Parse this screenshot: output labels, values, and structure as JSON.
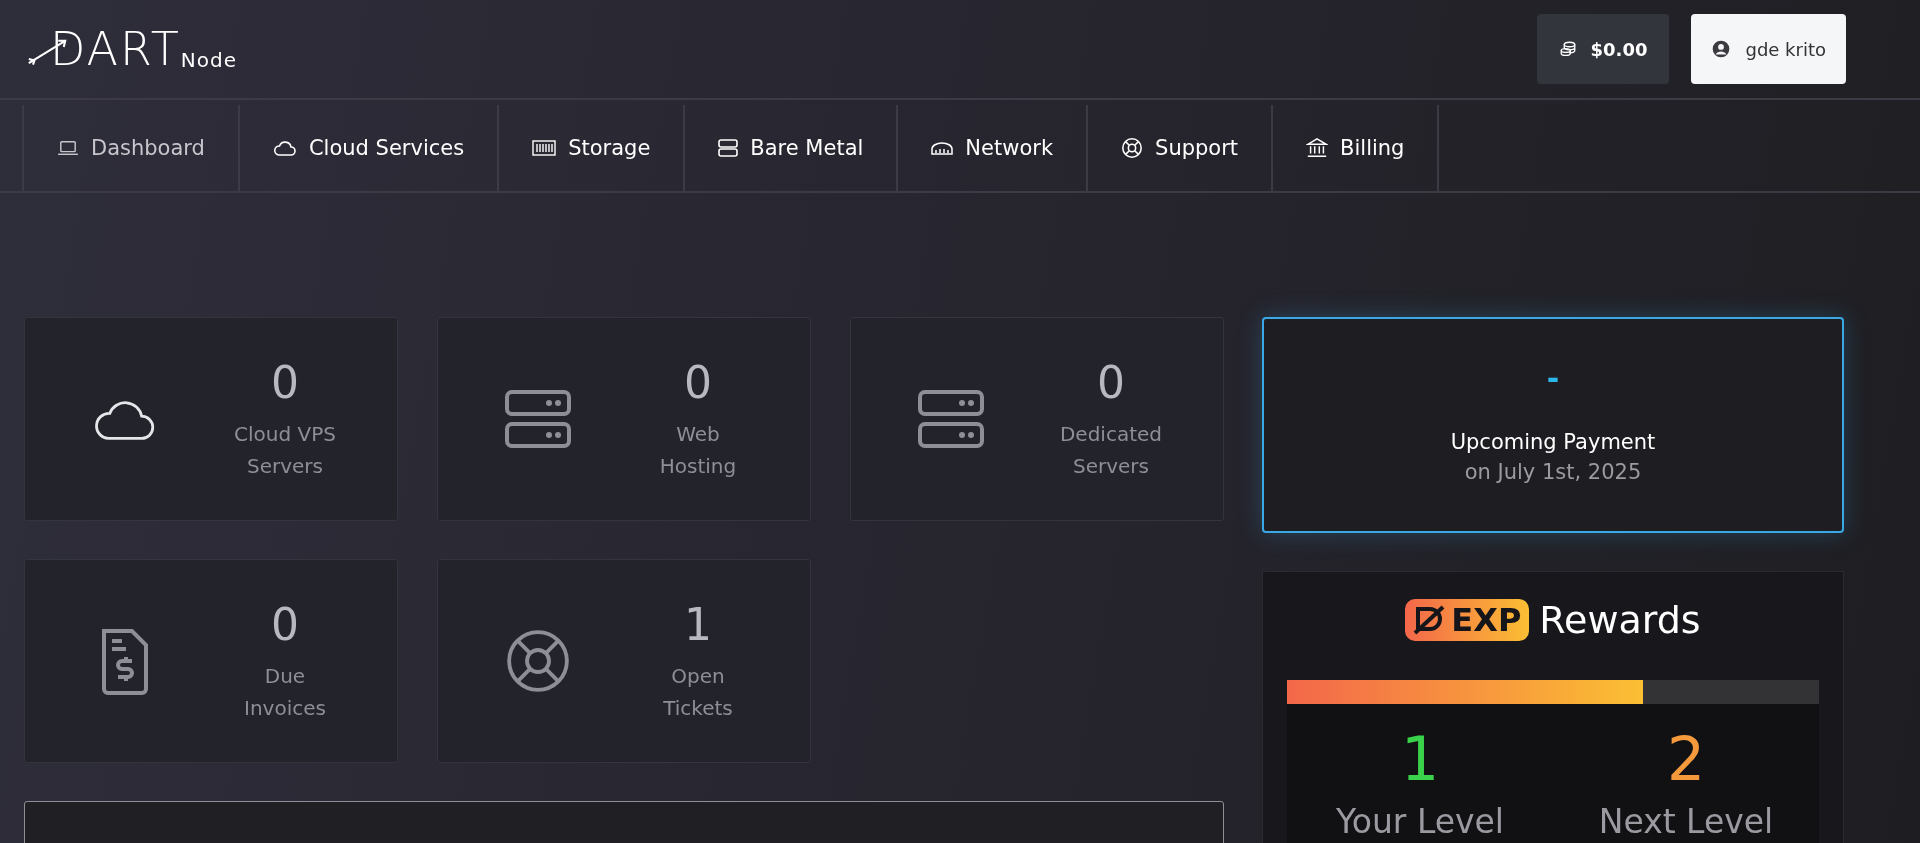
{
  "logo": {
    "main": "DART",
    "sub": "Node"
  },
  "header": {
    "balance": "$0.00",
    "user": "gde krito"
  },
  "nav": [
    {
      "label": "Dashboard",
      "kind": "laptop",
      "selected": true
    },
    {
      "label": "Cloud Services",
      "kind": "cloud",
      "selected": false
    },
    {
      "label": "Storage",
      "kind": "storage",
      "selected": false
    },
    {
      "label": "Bare Metal",
      "kind": "server",
      "selected": false
    },
    {
      "label": "Network",
      "kind": "network",
      "selected": false
    },
    {
      "label": "Support",
      "kind": "lifebuoy",
      "selected": false
    },
    {
      "label": "Billing",
      "kind": "bank",
      "selected": false
    }
  ],
  "stats": [
    {
      "kind": "cloud",
      "count": "0",
      "label": "Cloud VPS Servers"
    },
    {
      "kind": "server",
      "count": "0",
      "label": "Web Hosting"
    },
    {
      "kind": "server",
      "count": "0",
      "label": "Dedicated Servers"
    },
    {
      "kind": "invoice",
      "count": "0",
      "label": "Due Invoices"
    },
    {
      "kind": "lifebuoy",
      "count": "1",
      "label": "Open Tickets"
    }
  ],
  "upcoming_payment": {
    "amount": "-",
    "title": "Upcoming Payment",
    "date": "on July 1st, 2025"
  },
  "rewards": {
    "badge": "EXP",
    "title": "Rewards",
    "level": 0.67,
    "your_level": "1",
    "your_level_label": "Your Level",
    "next_level": "2",
    "next_level_label": "Next Level"
  }
}
